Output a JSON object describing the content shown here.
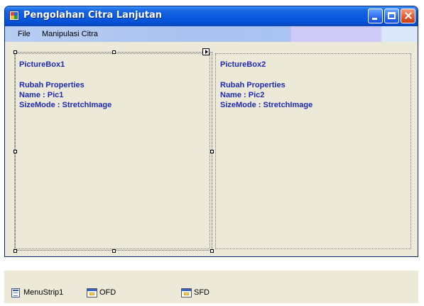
{
  "window": {
    "title": "Pengolahan Citra Lanjutan"
  },
  "menu": {
    "items": [
      {
        "label": "File"
      },
      {
        "label": "Manipulasi Citra"
      }
    ]
  },
  "pictureboxes": [
    {
      "name_line": "PictureBox1",
      "line2": "Rubah Properties",
      "line3": "Name : Pic1",
      "line4": "SizeMode : StretchImage"
    },
    {
      "name_line": "PictureBox2",
      "line2": "Rubah Properties",
      "line3": "Name : Pic2",
      "line4": "SizeMode : StretchImage"
    }
  ],
  "component_tray": [
    {
      "label": "MenuStrip1",
      "icon": "menustrip-icon"
    },
    {
      "label": "OFD",
      "icon": "open-file-dialog-icon"
    },
    {
      "label": "SFD",
      "icon": "save-file-dialog-icon"
    }
  ],
  "colors": {
    "titlebar": "#0b5ae0",
    "form_background": "#ece9d8",
    "annotation_text": "#1e2ab0"
  }
}
